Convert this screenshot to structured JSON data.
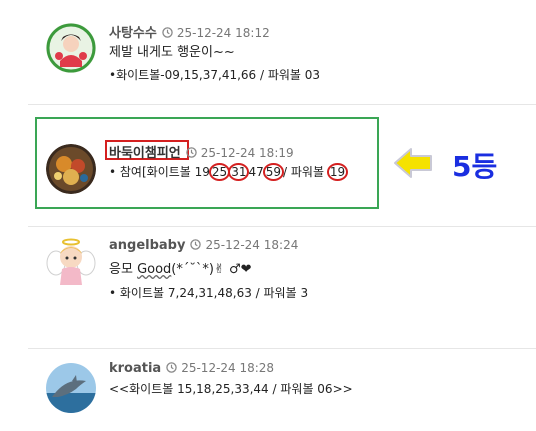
{
  "comments": [
    {
      "author": "사탕수수",
      "time": "25-12-24 18:12",
      "line1": "제발 내게도 행운이~~",
      "line2": "•화이트볼-09,15,37,41,66 / 파워볼 03"
    },
    {
      "author": "바둑이챔피언",
      "time": "25-12-24 18:19",
      "line_prefix": "• 참여[화이트볼 19",
      "circled": [
        "25",
        "31",
        "59",
        "19"
      ],
      "mid_a": "47",
      "mid_b": "/ 파워볼 "
    },
    {
      "author": "angelbaby",
      "time": "25-12-24 18:24",
      "line1_prefix": "응모 ",
      "line1_good": "Good",
      "line1_suffix": "(*´˘`*)✌ ♂❤",
      "line2": "• 화이트볼 7,24,31,48,63 / 파워볼 3"
    },
    {
      "author": "kroatia",
      "time": "25-12-24 18:28",
      "line1": "<<화이트볼 15,18,25,33,44 / 파워볼 06>>"
    }
  ],
  "annotation": {
    "rank_label": "5등",
    "colors": {
      "highlight_box": "#3aa655",
      "circle": "#d42020",
      "arrow": "#f5e200",
      "rank": "#1a2ee0"
    }
  }
}
